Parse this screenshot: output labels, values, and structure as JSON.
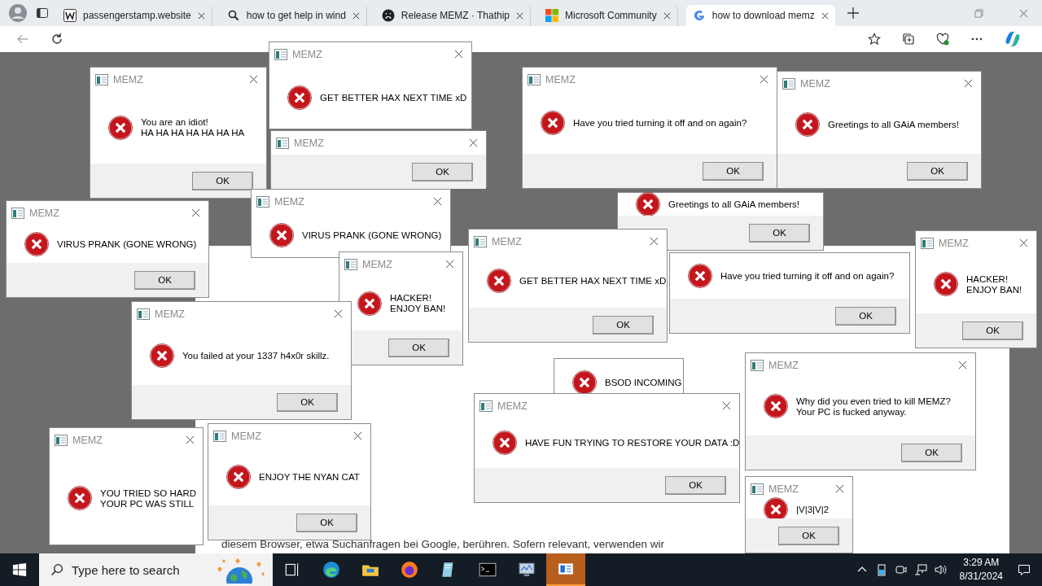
{
  "browser": {
    "tabs": [
      {
        "label": "passengerstamp.website",
        "selected": false
      },
      {
        "label": "how to get help in wind",
        "selected": false
      },
      {
        "label": "Release MEMZ · Thathip",
        "selected": false
      },
      {
        "label": "Microsoft Community",
        "selected": false
      },
      {
        "label": "how to download memz",
        "selected": true
      }
    ]
  },
  "page": {
    "text": "diesem Browser, etwa Suchanfragen bei Google, berühren. Sofern relevant, verwenden wir"
  },
  "dialogs": [
    {
      "title": "MEMZ",
      "message": [
        "GET BETTER HAX NEXT TIME xD"
      ]
    },
    {
      "title": "MEMZ",
      "message": [
        "You are an idiot!",
        "HA HA HA HA HA HA HA"
      ],
      "button": "OK"
    },
    {
      "title": "MEMZ",
      "button": "OK"
    },
    {
      "title": "MEMZ",
      "message": [
        "Have you tried turning it off and on again?"
      ],
      "button": "OK"
    },
    {
      "title": "MEMZ",
      "message": [
        "Greetings to all GAiA members!"
      ],
      "button": "OK"
    },
    {
      "title": "MEMZ",
      "message": [
        "VIRUS PRANK (GONE WRONG)"
      ]
    },
    {
      "message": [
        "Greetings to all GAiA members!"
      ],
      "button": "OK"
    },
    {
      "title": "MEMZ",
      "message": [
        "VIRUS PRANK (GONE WRONG)"
      ],
      "button": "OK"
    },
    {
      "title": "MEMZ",
      "message": [
        "GET BETTER HAX NEXT TIME xD"
      ],
      "button": "OK"
    },
    {
      "title": "MEMZ",
      "message": [
        "HACKER!",
        "ENJOY BAN!"
      ],
      "button": "OK"
    },
    {
      "title": "MEMZ",
      "message": [
        "HACKER!",
        "ENJOY BAN!"
      ],
      "button": "OK"
    },
    {
      "message": [
        "Have you tried turning it off and on again?"
      ],
      "button": "OK"
    },
    {
      "title": "MEMZ",
      "message": [
        "You failed at your 1337 h4x0r skillz."
      ],
      "button": "OK"
    },
    {
      "message": [
        "BSOD INCOMING"
      ]
    },
    {
      "title": "MEMZ",
      "message": [
        "Why did you even tried to kill MEMZ?",
        "Your PC is fucked anyway."
      ],
      "button": "OK"
    },
    {
      "title": "MEMZ",
      "message": [
        "YOU TRIED SO HARD",
        "YOUR PC WAS STILL"
      ]
    },
    {
      "title": "MEMZ",
      "message": [
        "ENJOY THE NYAN CAT"
      ],
      "button": "OK"
    },
    {
      "title": "MEMZ",
      "message": [
        "HAVE FUN TRYING TO RESTORE YOUR DATA :D"
      ],
      "button": "OK"
    },
    {
      "title": "MEMZ",
      "message": [
        "|V|3|V|2"
      ],
      "button": "OK"
    }
  ],
  "taskbar": {
    "search_placeholder": "Type here to search",
    "time": "3:29 AM",
    "date": "8/31/2024"
  }
}
